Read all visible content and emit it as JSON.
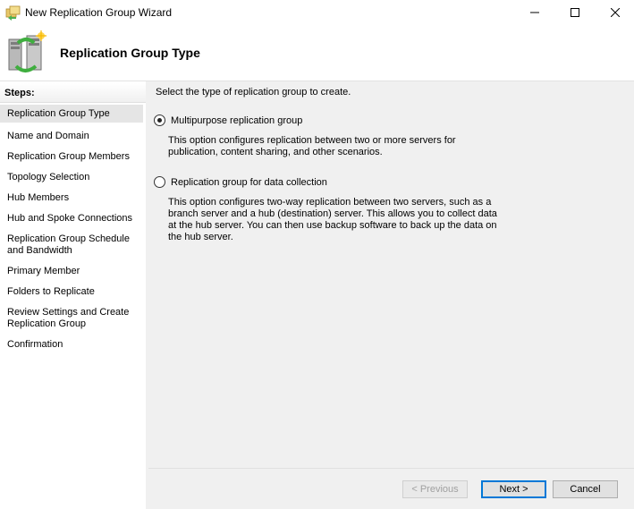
{
  "window": {
    "title": "New Replication Group Wizard"
  },
  "header": {
    "title": "Replication Group Type"
  },
  "sidebar": {
    "steps_label": "Steps:",
    "items": [
      {
        "label": "Replication Group Type",
        "active": true
      },
      {
        "label": "Name and Domain"
      },
      {
        "label": "Replication Group Members"
      },
      {
        "label": "Topology Selection"
      },
      {
        "label": "Hub Members"
      },
      {
        "label": "Hub and Spoke Connections"
      },
      {
        "label": "Replication Group Schedule and Bandwidth"
      },
      {
        "label": "Primary Member"
      },
      {
        "label": "Folders to Replicate"
      },
      {
        "label": "Review Settings and Create Replication Group"
      },
      {
        "label": "Confirmation"
      }
    ]
  },
  "main": {
    "instruction": "Select the type of replication group to create.",
    "options": [
      {
        "label": "Multipurpose replication group",
        "selected": true,
        "description": "This option configures replication between two or more servers for publication, content sharing, and other scenarios."
      },
      {
        "label": "Replication group for data collection",
        "selected": false,
        "description": "This option configures two-way replication between two servers, such as a branch server and a hub (destination) server. This allows you to collect data at the hub server. You can then use backup software to back up the data on the hub server."
      }
    ]
  },
  "buttons": {
    "previous": "< Previous",
    "next": "Next >",
    "cancel": "Cancel"
  },
  "icons": {
    "app": "folder-replication-icon",
    "header": "servers-sync-icon",
    "minimize": "minimize-icon",
    "maximize": "maximize-icon",
    "close": "close-icon"
  }
}
